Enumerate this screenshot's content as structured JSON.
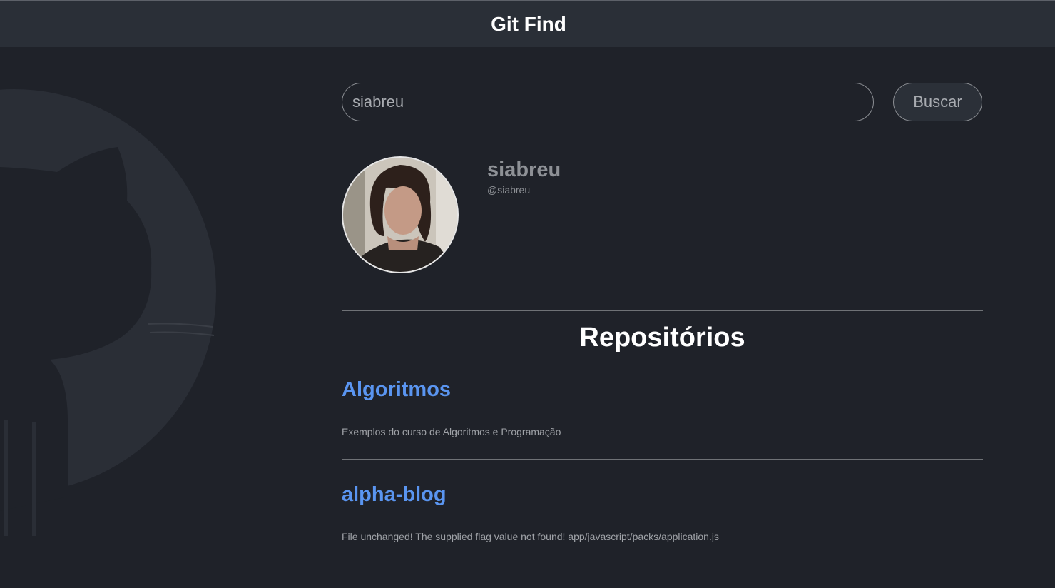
{
  "header": {
    "title": "Git Find"
  },
  "search": {
    "value": "siabreu",
    "button_label": "Buscar"
  },
  "profile": {
    "name": "siabreu",
    "login": "@siabreu"
  },
  "repos_section": {
    "title": "Repositórios",
    "items": [
      {
        "name": "Algoritmos",
        "description": "Exemplos do curso de Algoritmos e Programação"
      },
      {
        "name": "alpha-blog",
        "description": "File unchanged! The supplied flag value not found! app/javascript/packs/application.js"
      }
    ]
  },
  "colors": {
    "background": "#1f2229",
    "header": "#2a2f37",
    "link": "#5a95f0",
    "muted_text": "#8e9196"
  },
  "icons": {
    "background_logo": "github-octocat-icon"
  }
}
